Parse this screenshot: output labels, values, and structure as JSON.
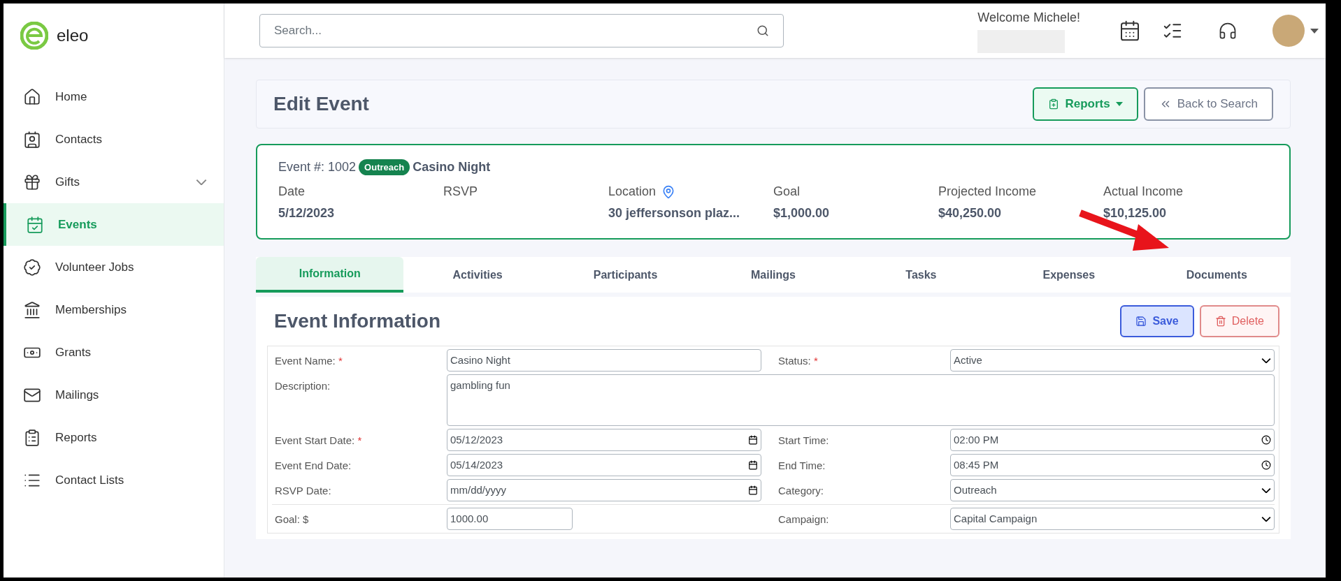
{
  "logo": {
    "text": "eleo"
  },
  "sidebar": {
    "items": [
      {
        "label": "Home",
        "selected": false,
        "expandable": false
      },
      {
        "label": "Contacts",
        "selected": false,
        "expandable": false
      },
      {
        "label": "Gifts",
        "selected": false,
        "expandable": true
      },
      {
        "label": "Events",
        "selected": true,
        "expandable": false
      },
      {
        "label": "Volunteer Jobs",
        "selected": false,
        "expandable": false
      },
      {
        "label": "Memberships",
        "selected": false,
        "expandable": false
      },
      {
        "label": "Grants",
        "selected": false,
        "expandable": false
      },
      {
        "label": "Mailings",
        "selected": false,
        "expandable": false
      },
      {
        "label": "Reports",
        "selected": false,
        "expandable": false
      },
      {
        "label": "Contact Lists",
        "selected": false,
        "expandable": false
      }
    ]
  },
  "header": {
    "search": {
      "placeholder": "Search..."
    },
    "welcome": "Welcome Michele!"
  },
  "page": {
    "title": "Edit Event",
    "buttons": [
      {
        "label": "Reports",
        "kind": "primary"
      },
      {
        "label": "Back to Search",
        "kind": "secondary"
      }
    ]
  },
  "summary": {
    "event_number": "Event #: 1002",
    "tag": "Outreach",
    "name": "Casino Night",
    "fields": [
      {
        "label": "Date",
        "value": "5/12/2023"
      },
      {
        "label": "RSVP"
      },
      {
        "label": "Location",
        "value": "30 jeffersonson plaz...",
        "kind": "location"
      },
      {
        "label": "Goal",
        "value": "$1,000.00"
      },
      {
        "label": "Projected Income",
        "value": "$40,250.00"
      },
      {
        "label": "Actual Income",
        "value": "$10,125.00"
      }
    ]
  },
  "tabs": [
    {
      "label": "Information",
      "selected": true
    },
    {
      "label": "Activities",
      "selected": false
    },
    {
      "label": "Participants",
      "selected": false
    },
    {
      "label": "Mailings",
      "selected": false
    },
    {
      "label": "Tasks",
      "selected": false
    },
    {
      "label": "Expenses",
      "selected": false
    },
    {
      "label": "Documents",
      "selected": false
    }
  ],
  "form": {
    "title": "Event Information",
    "buttons": [
      {
        "label": "Save",
        "kind": "save"
      },
      {
        "label": "Delete",
        "kind": "delete"
      }
    ],
    "rows": [
      [
        {
          "label": "Event Name:",
          "required_mark": "*",
          "kind": "text",
          "value": "Casino Night"
        },
        {
          "label": "Status:",
          "required_mark": "*",
          "kind": "select",
          "value": "Active"
        }
      ],
      [
        {
          "label": "Description:",
          "kind": "textarea",
          "value": "gambling fun"
        }
      ],
      [
        {
          "label": "Event Start Date:",
          "required_mark": "*",
          "kind": "date",
          "value": "05/12/2023"
        },
        {
          "label": "Start Time:",
          "kind": "time",
          "value": "02:00  PM"
        }
      ],
      [
        {
          "label": "Event End Date:",
          "kind": "date",
          "value": "05/14/2023"
        },
        {
          "label": "End Time:",
          "kind": "time",
          "value": "08:45  PM"
        }
      ],
      [
        {
          "label": "RSVP Date:",
          "kind": "date",
          "value": "mm/dd/yyyy"
        },
        {
          "label": "Category:",
          "kind": "select",
          "value": "Outreach"
        }
      ],
      [
        {
          "label": "Goal: $",
          "kind": "short",
          "value": "1000.00"
        },
        {
          "label": "Campaign:",
          "kind": "select",
          "value": "Capital Campaign"
        }
      ]
    ]
  }
}
